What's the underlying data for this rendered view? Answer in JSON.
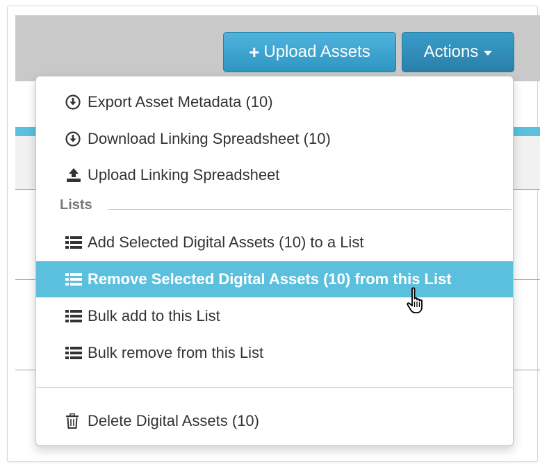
{
  "toolbar": {
    "upload_label": "Upload Assets",
    "actions_label": "Actions"
  },
  "menu": {
    "items_top": [
      {
        "label": "Export Asset Metadata (10)",
        "icon": "download-circle-icon"
      },
      {
        "label": "Download Linking Spreadsheet (10)",
        "icon": "download-circle-icon"
      },
      {
        "label": "Upload Linking Spreadsheet",
        "icon": "upload-icon"
      }
    ],
    "lists_header": "Lists",
    "list_items": [
      {
        "label": "Add Selected Digital Assets (10) to a List",
        "icon": "list-icon"
      },
      {
        "label": "Remove Selected Digital Assets (10) from this List",
        "icon": "list-icon",
        "active": true
      },
      {
        "label": "Bulk add to this List",
        "icon": "list-icon"
      },
      {
        "label": "Bulk remove from this List",
        "icon": "list-icon"
      }
    ],
    "delete_item": {
      "label": "Delete Digital Assets (10)",
      "icon": "trash-icon"
    }
  },
  "colors": {
    "highlight": "#5bc0de",
    "button_blue": "#3aa8d6",
    "text": "#333333"
  }
}
